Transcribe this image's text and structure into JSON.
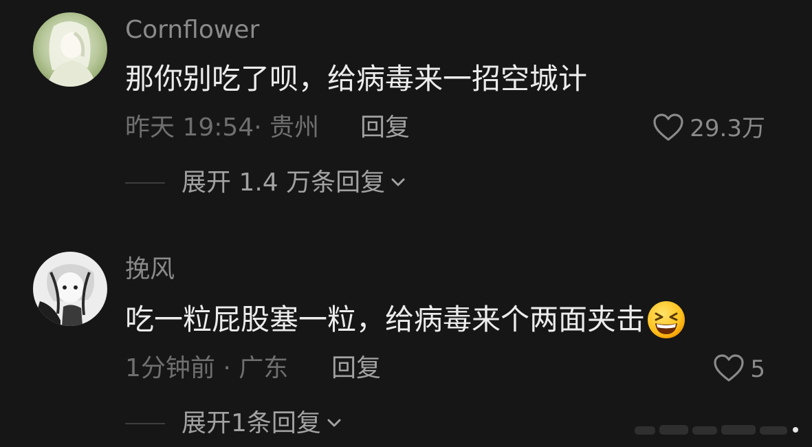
{
  "comments": [
    {
      "username": "Cornflower",
      "text": "那你别吃了呗，给病毒来一招空城计",
      "emoji": "",
      "meta": "昨天 19:54· 贵州",
      "reply_label": "回复",
      "like_count": "29.3万",
      "expand_label": "展开 1.4 万条回复"
    },
    {
      "username": "挽风",
      "text": "吃一粒屁股塞一粒，给病毒来个两面夹击",
      "emoji": "grinning-squinting-face",
      "meta": "1分钟前 · 广东",
      "reply_label": "回复",
      "like_count": "5",
      "expand_label": "展开1条回复"
    }
  ],
  "icons": {
    "like": "heart-outline-icon",
    "expand": "chevron-down-icon"
  },
  "colors": {
    "background": "#161616",
    "text_primary": "#ececec",
    "text_secondary": "#8a8a8a",
    "text_meta": "#6f6f6f"
  }
}
